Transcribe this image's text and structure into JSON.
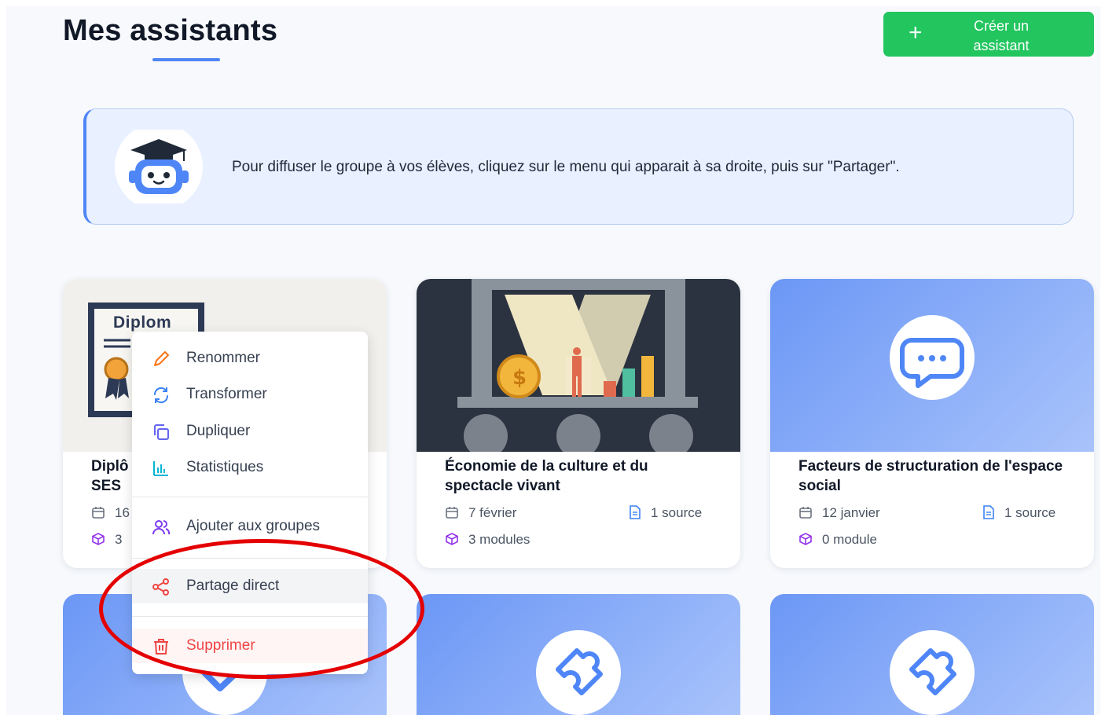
{
  "header": {
    "title": "Mes assistants",
    "create_button": {
      "icon": "plus-icon",
      "label": "Créer un assistant"
    }
  },
  "banner": {
    "icon": "robot-graduate-icon",
    "message": "Pour diffuser le groupe à vos élèves, cliquez sur le menu qui apparait à sa droite, puis sur \"Partager\"."
  },
  "cards": [
    {
      "title_visible": "Diplô\nSES",
      "thumb_text": "Diplom",
      "date_visible": "16",
      "modules_visible": "3"
    },
    {
      "title": "Économie de la culture et du spectacle vivant",
      "date": "7 février",
      "sources": "1 source",
      "modules": "3 modules"
    },
    {
      "title": "Facteurs de structuration de l'espace social",
      "date": "12 janvier",
      "sources": "1 source",
      "modules": "0 module"
    }
  ],
  "context_menu": {
    "items": [
      {
        "label": "Renommer",
        "icon": "pencil-icon",
        "color": "#f97316"
      },
      {
        "label": "Transformer",
        "icon": "refresh-icon",
        "color": "#3b82f6"
      },
      {
        "label": "Dupliquer",
        "icon": "copy-icon",
        "color": "#6366f1"
      },
      {
        "label": "Statistiques",
        "icon": "bar-chart-icon",
        "color": "#06b6d4"
      },
      {
        "label": "Ajouter aux groupes",
        "icon": "users-icon",
        "color": "#7c3aed"
      },
      {
        "label": "Partage direct",
        "icon": "share-icon",
        "color": "#ef4444"
      },
      {
        "label": "Supprimer",
        "icon": "trash-icon",
        "color": "#ef4444"
      }
    ]
  },
  "colors": {
    "accent": "#4f86f7",
    "create_green": "#22c55e",
    "danger": "#ef4444",
    "annotation_red": "#e40000"
  }
}
